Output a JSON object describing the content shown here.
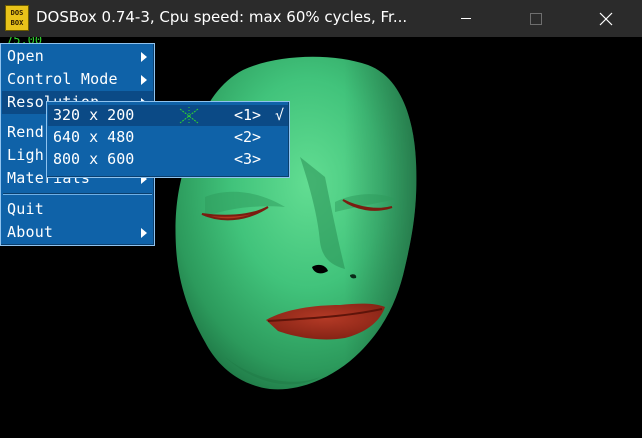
{
  "window": {
    "title": "DOSBox 0.74-3, Cpu speed: max  60% cycles, Fr...",
    "icon_top": "DOS",
    "icon_bottom": "BOX",
    "icon_name": "dosbox-app-icon",
    "controls": [
      "minimize-icon",
      "maximize-icon",
      "close-icon"
    ]
  },
  "screen": {
    "fps_text": "75.00",
    "menu": {
      "items": [
        {
          "label": "Open",
          "submenu": true
        },
        {
          "label": "Control Mode",
          "submenu": true
        },
        {
          "label": "Resolution",
          "submenu": true,
          "active": true
        },
        {
          "label": "Rend",
          "submenu": true
        },
        {
          "label": "Ligh",
          "submenu": true
        },
        {
          "label": "Materials",
          "submenu": true
        },
        {
          "label": "Quit",
          "submenu": false
        },
        {
          "label": "About",
          "submenu": true
        }
      ]
    },
    "resolution_submenu": {
      "items": [
        {
          "label": "320 x 200",
          "key": "<1>",
          "check": "√",
          "selected": true
        },
        {
          "label": "640 x 480",
          "key": "<2>",
          "check": ""
        },
        {
          "label": "800 x 600",
          "key": "<3>",
          "check": ""
        }
      ]
    },
    "colors": {
      "menu_bg": "#0f62a8",
      "menu_highlight": "#0b4a86",
      "face_green": "#3fbf7a",
      "lips": "#a52a1a",
      "titlebar": "#2b2b2b"
    }
  }
}
